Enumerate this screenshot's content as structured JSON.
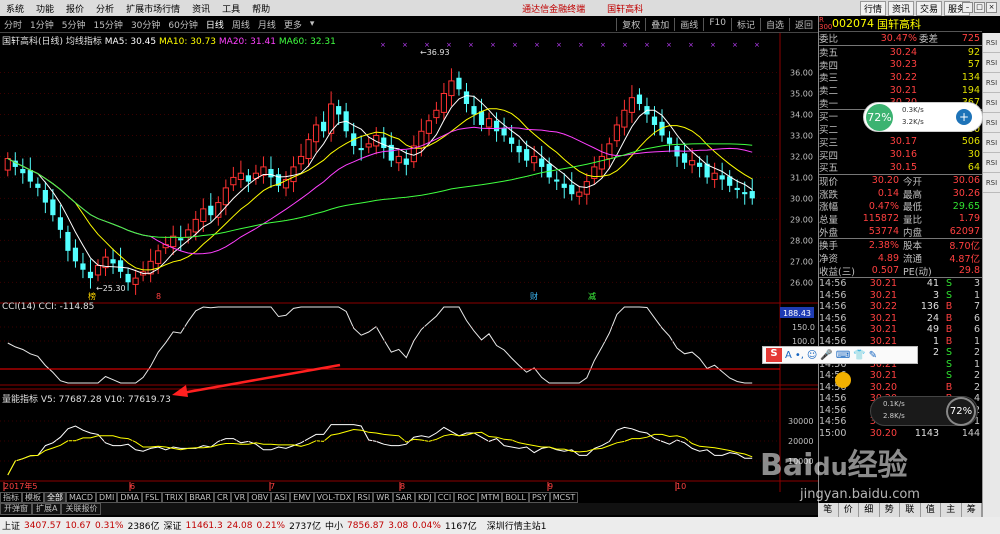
{
  "menu": {
    "items": [
      "系统",
      "功能",
      "报价",
      "分析",
      "扩展市场行情",
      "资讯",
      "工具",
      "帮助"
    ],
    "app_title": "通达信金融终端",
    "stock_title": "国轩高科"
  },
  "right_tabs": [
    "行情",
    "资讯",
    "交易",
    "服务"
  ],
  "toolbar": {
    "periods": [
      "分时",
      "1分钟",
      "5分钟",
      "15分钟",
      "30分钟",
      "60分钟",
      "日线",
      "周线",
      "月线",
      "更多"
    ],
    "active": "日线",
    "right_buttons": [
      "复权",
      "叠加",
      "画线",
      "F10",
      "标记",
      "自选",
      "返回"
    ]
  },
  "ma_line": {
    "name": "国轩高科(日线)",
    "indicator": "均线指标",
    "ma5": "MA5: 30.45",
    "ma10": "MA10: 30.73",
    "ma20": "MA20: 31.41",
    "ma60": "MA60: 32.31"
  },
  "chart_labels": {
    "high": "36.93",
    "low": "25.30",
    "markers": [
      "榜",
      "8",
      "财",
      "减"
    ],
    "cci": "CCI(14)  CCI: -114.85",
    "cci_value": "188.43",
    "vol": "量能指标  V5: 77687.28  V10: 77619.73",
    "dates": [
      "2017年5",
      "6",
      "7",
      "8",
      "9",
      "10"
    ],
    "price_ticks": [
      "36.00",
      "35.00",
      "34.00",
      "33.00",
      "32.00",
      "31.00",
      "30.00",
      "29.00",
      "28.00",
      "27.00",
      "26.00"
    ],
    "cci_ticks": [
      "150.0",
      "100.0"
    ],
    "vol_ticks": [
      "30000",
      "20000",
      "10000"
    ]
  },
  "chart_data": {
    "type": "candlestick",
    "x": [
      "2017-05",
      "2017-06",
      "2017-07",
      "2017-08",
      "2017-09",
      "2017-10"
    ],
    "close": [
      31.9,
      31.5,
      31.2,
      30.8,
      30.5,
      29.8,
      29.2,
      28.5,
      27.5,
      27.0,
      26.6,
      26.2,
      26.8,
      27.2,
      26.9,
      26.5,
      26.0,
      26.2,
      26.5,
      27.0,
      27.5,
      27.8,
      28.2,
      28.0,
      28.5,
      29.0,
      29.5,
      29.2,
      29.8,
      30.5,
      31.0,
      31.2,
      30.8,
      31.2,
      31.5,
      31.0,
      30.6,
      30.9,
      31.5,
      32.0,
      32.8,
      33.5,
      33.2,
      34.5,
      34.0,
      33.2,
      32.5,
      32.3,
      32.6,
      33.0,
      32.4,
      31.8,
      32.0,
      31.6,
      32.5,
      33.2,
      33.7,
      34.2,
      35.0,
      35.6,
      35.2,
      34.5,
      34.0,
      33.5,
      33.8,
      33.2,
      33.0,
      32.6,
      32.2,
      31.8,
      32.0,
      31.5,
      31.0,
      30.8,
      30.5,
      30.2,
      30.3,
      30.8,
      31.5,
      32.0,
      32.6,
      33.5,
      34.2,
      34.8,
      34.5,
      34.0,
      33.5,
      33.0,
      32.6,
      32.0,
      31.7,
      31.8,
      31.5,
      31.0,
      31.2,
      30.9,
      30.6,
      30.4,
      30.2,
      30.0
    ],
    "price_range": [
      25.3,
      36.93
    ],
    "ma_values": {
      "MA5": 30.45,
      "MA10": 30.73,
      "MA20": 31.41,
      "MA60": 32.31
    },
    "cci_last": -114.85,
    "volume_ma": {
      "V5": 77687.28,
      "V10": 77619.73
    }
  },
  "panel": {
    "code_prefix": "R 300",
    "code": "002074",
    "name": "国轩高科",
    "ratio": {
      "l1": "委比",
      "v1": "30.47%",
      "l2": "委差",
      "v2": "725"
    },
    "asks": [
      {
        "label": "卖五",
        "price": "30.24",
        "vol": "92"
      },
      {
        "label": "卖四",
        "price": "30.23",
        "vol": "57"
      },
      {
        "label": "卖三",
        "price": "30.22",
        "vol": "134"
      },
      {
        "label": "卖二",
        "price": "30.21",
        "vol": "194"
      },
      {
        "label": "卖一",
        "price": "30.20",
        "vol": "367"
      }
    ],
    "bids": [
      {
        "label": "买一",
        "price": "30.19",
        "vol": "527"
      },
      {
        "label": "买二",
        "price": "30.18",
        "vol": "450"
      },
      {
        "label": "买三",
        "price": "30.17",
        "vol": "506"
      },
      {
        "label": "买四",
        "price": "30.16",
        "vol": "30"
      },
      {
        "label": "买五",
        "price": "30.15",
        "vol": "64"
      }
    ],
    "stats": [
      {
        "l1": "现价",
        "v1": "30.20",
        "l2": "今开",
        "v2": "30.06"
      },
      {
        "l1": "涨跌",
        "v1": "0.14",
        "l2": "最高",
        "v2": "30.26"
      },
      {
        "l1": "涨幅",
        "v1": "0.47%",
        "l2": "最低",
        "v2": "29.65"
      },
      {
        "l1": "总量",
        "v1": "115872",
        "l2": "量比",
        "v2": "1.79"
      },
      {
        "l1": "外盘",
        "v1": "53774",
        "l2": "内盘",
        "v2": "62097"
      }
    ],
    "stats2": [
      {
        "l1": "换手",
        "v1": "2.38%",
        "l2": "股本",
        "v2": "8.70亿"
      },
      {
        "l1": "净资",
        "v1": "4.89",
        "l2": "流通",
        "v2": "4.87亿"
      },
      {
        "l1": "收益(三)",
        "v1": "0.507",
        "l2": "PE(动)",
        "v2": "29.8"
      }
    ],
    "ticks": [
      {
        "t": "14:56",
        "p": "30.21",
        "v": "41",
        "f": "S",
        "n": "3"
      },
      {
        "t": "14:56",
        "p": "30.21",
        "v": "3",
        "f": "S",
        "n": "1"
      },
      {
        "t": "14:56",
        "p": "30.22",
        "v": "136",
        "f": "B",
        "n": "7"
      },
      {
        "t": "14:56",
        "p": "30.21",
        "v": "24",
        "f": "B",
        "n": "6"
      },
      {
        "t": "14:56",
        "p": "30.21",
        "v": "49",
        "f": "B",
        "n": "6"
      },
      {
        "t": "14:56",
        "p": "30.21",
        "v": "1",
        "f": "B",
        "n": "1"
      },
      {
        "t": "14:56",
        "p": "30.21",
        "v": "2",
        "f": "S",
        "n": "2"
      },
      {
        "t": "14:56",
        "p": "30.21",
        "v": "",
        "f": "S",
        "n": "1"
      },
      {
        "t": "14:56",
        "p": "30.21",
        "v": "",
        "f": "S",
        "n": "2"
      },
      {
        "t": "14:56",
        "p": "30.20",
        "v": "",
        "f": "B",
        "n": "2"
      },
      {
        "t": "14:56",
        "p": "30.20",
        "v": "",
        "f": "B",
        "n": "4"
      },
      {
        "t": "14:56",
        "p": "30.21",
        "v": "",
        "f": "S",
        "n": "2"
      },
      {
        "t": "14:56",
        "p": "30.21",
        "v": "",
        "f": "S",
        "n": "1"
      },
      {
        "t": "15:00",
        "p": "30.20",
        "v": "1143",
        "f": "",
        "n": "144"
      }
    ],
    "speed1": {
      "pct": "72%",
      "up": "0.3K/s",
      "down": "3.2K/s"
    },
    "speed2": {
      "pct": "72%",
      "up": "0.1K/s",
      "down": "2.8K/s"
    },
    "bottom_tabs": [
      "笔",
      "价",
      "细",
      "势",
      "联",
      "值",
      "主",
      "筹"
    ]
  },
  "right_scroll": [
    "RSI",
    "RSI",
    "RSI",
    "RSI",
    "RSI",
    "RSI",
    "RSI",
    "RSI"
  ],
  "indicators": [
    "指标",
    "模板",
    "全部",
    "MACD",
    "DMI",
    "DMA",
    "FSL",
    "TRIX",
    "BRAR",
    "CR",
    "VR",
    "OBV",
    "ASI",
    "EMV",
    "VOL-TDX",
    "RSI",
    "WR",
    "SAR",
    "KDJ",
    "CCI",
    "ROC",
    "MTM",
    "BOLL",
    "PSY",
    "MCST"
  ],
  "indicators_active": "全部",
  "bottom_tabs": [
    "开弹窗",
    "扩展A",
    "关联报价"
  ],
  "status": {
    "sh_label": "上证",
    "sh_val": "3407.57",
    "sh_chg": "10.67",
    "sh_pct": "0.31%",
    "sh_amt": "2386亿",
    "sz_label": "深证",
    "sz_val": "11461.3",
    "sz_chg": "24.08",
    "sz_pct": "0.21%",
    "sz_amt": "2737亿",
    "zx_label": "中小",
    "zx_val": "7856.87",
    "zx_chg": "3.08",
    "zx_pct": "0.04%",
    "zx_amt": "1167亿",
    "right": "深圳行情主站1"
  },
  "ime": {
    "label": "S",
    "mode": "A"
  },
  "watermark": {
    "brand": "Baidu经验",
    "url": "jingyan.baidu.com"
  }
}
